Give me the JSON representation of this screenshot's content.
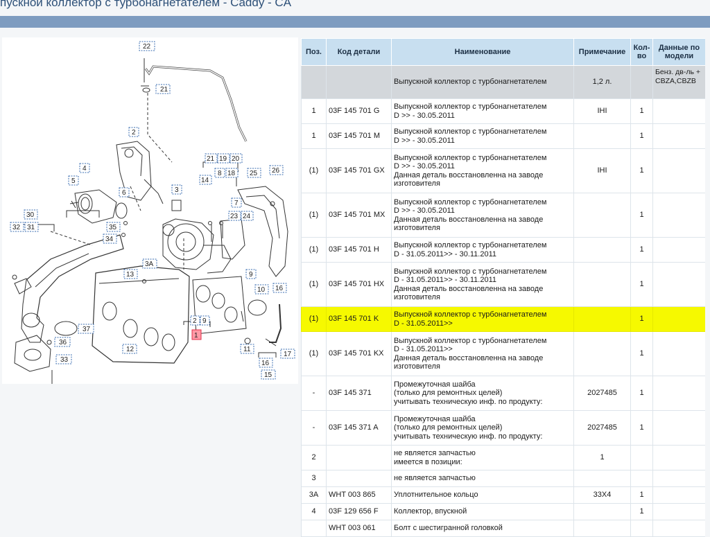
{
  "page": {
    "title": "пускной коллектор с турбонагнетателем - Caddy - CA"
  },
  "table": {
    "headers": {
      "pos": "Поз.",
      "code": "Код детали",
      "name": "Наименование",
      "note": "Примечание",
      "qty": "Кол-во",
      "model": "Данные по модели"
    },
    "rows": [
      {
        "pos": "",
        "code": "",
        "name": [
          "Выпускной коллектор с турбонагнетателем"
        ],
        "note": "1,2 л.",
        "qty": "",
        "model": "Бенз. дв-ль + CBZA,CBZB",
        "group": true
      },
      {
        "pos": "1",
        "code": "03F 145 701 G",
        "name": [
          "Выпускной коллектор с турбонагнетателем",
          "D >> - 30.05.2011"
        ],
        "note": "IHI",
        "qty": "1",
        "model": ""
      },
      {
        "pos": "1",
        "code": "03F 145 701 M",
        "name": [
          "Выпускной коллектор с турбонагнетателем",
          "D >> - 30.05.2011"
        ],
        "note": "",
        "qty": "1",
        "model": ""
      },
      {
        "pos": "(1)",
        "code": "03F 145 701 GX",
        "name": [
          "Выпускной коллектор с турбонагнетателем",
          "D >> - 30.05.2011",
          "Данная деталь восстановленна на заводе",
          "изготовителя"
        ],
        "note": "IHI",
        "qty": "1",
        "model": ""
      },
      {
        "pos": "(1)",
        "code": "03F 145 701 MX",
        "name": [
          "Выпускной коллектор с турбонагнетателем",
          "D >> - 30.05.2011",
          "Данная деталь восстановленна на заводе",
          "изготовителя"
        ],
        "note": "",
        "qty": "1",
        "model": ""
      },
      {
        "pos": "(1)",
        "code": "03F 145 701 H",
        "name": [
          "Выпускной коллектор с турбонагнетателем",
          "D - 31.05.2011>> - 30.11.2011"
        ],
        "note": "",
        "qty": "1",
        "model": ""
      },
      {
        "pos": "(1)",
        "code": "03F 145 701 HX",
        "name": [
          "Выпускной коллектор с турбонагнетателем",
          "D - 31.05.2011>> - 30.11.2011",
          "Данная деталь восстановленна на заводе",
          "изготовителя"
        ],
        "note": "",
        "qty": "1",
        "model": ""
      },
      {
        "pos": "(1)",
        "code": "03F 145 701 K",
        "name": [
          "Выпускной коллектор с турбонагнетателем",
          "D - 31.05.2011>>"
        ],
        "note": "",
        "qty": "1",
        "model": "",
        "highlight": true
      },
      {
        "pos": "(1)",
        "code": "03F 145 701 KX",
        "name": [
          "Выпускной коллектор с турбонагнетателем",
          "D - 31.05.2011>>",
          "Данная деталь восстановленна на заводе",
          "изготовителя"
        ],
        "note": "",
        "qty": "1",
        "model": ""
      },
      {
        "pos": "-",
        "code": "03F 145 371",
        "name": [
          "Промежуточная шайба",
          "(только для ремонтных целей)",
          "учитывать техническую инф. по продукту:"
        ],
        "note": "2027485",
        "qty": "1",
        "model": ""
      },
      {
        "pos": "-",
        "code": "03F 145 371 A",
        "name": [
          "Промежуточная шайба",
          "(только для ремонтных целей)",
          "учитывать техническую инф. по продукту:"
        ],
        "note": "2027485",
        "qty": "1",
        "model": ""
      },
      {
        "pos": "2",
        "code": "",
        "name": [
          "не является запчастью",
          "имеется в позиции:"
        ],
        "note": "1",
        "qty": "",
        "model": ""
      },
      {
        "pos": "3",
        "code": "",
        "name": [
          "не является запчастью"
        ],
        "note": "",
        "qty": "",
        "model": ""
      },
      {
        "pos": "3A",
        "code": "WHT 003 865",
        "name": [
          "Уплотнительное кольцо"
        ],
        "note": "33X4",
        "qty": "1",
        "model": ""
      },
      {
        "pos": "4",
        "code": "03F 129 656 F",
        "name": [
          "Коллектор, впускной"
        ],
        "note": "",
        "qty": "1",
        "model": ""
      },
      {
        "pos": "",
        "code": "WHT 003 061",
        "name": [
          "Болт с шестигранной головкой"
        ],
        "note": "",
        "qty": "",
        "model": ""
      }
    ]
  },
  "diagram": {
    "callouts": [
      "22",
      "21",
      "2",
      "4",
      "5",
      "6",
      "3",
      "19",
      "20",
      "21",
      "8",
      "18",
      "14",
      "25",
      "26",
      "7",
      "23",
      "24",
      "30",
      "32",
      "31",
      "35",
      "34",
      "3A",
      "13",
      "9",
      "10",
      "16",
      "2",
      "9",
      "1",
      "37",
      "36",
      "33",
      "12",
      "11",
      "17",
      "16",
      "15",
      "20"
    ],
    "colors": {
      "callout_border": "#3a6cb0",
      "highlight_callout_fill": "#ff9aa6",
      "highlight_callout_border": "#e0304a"
    }
  }
}
